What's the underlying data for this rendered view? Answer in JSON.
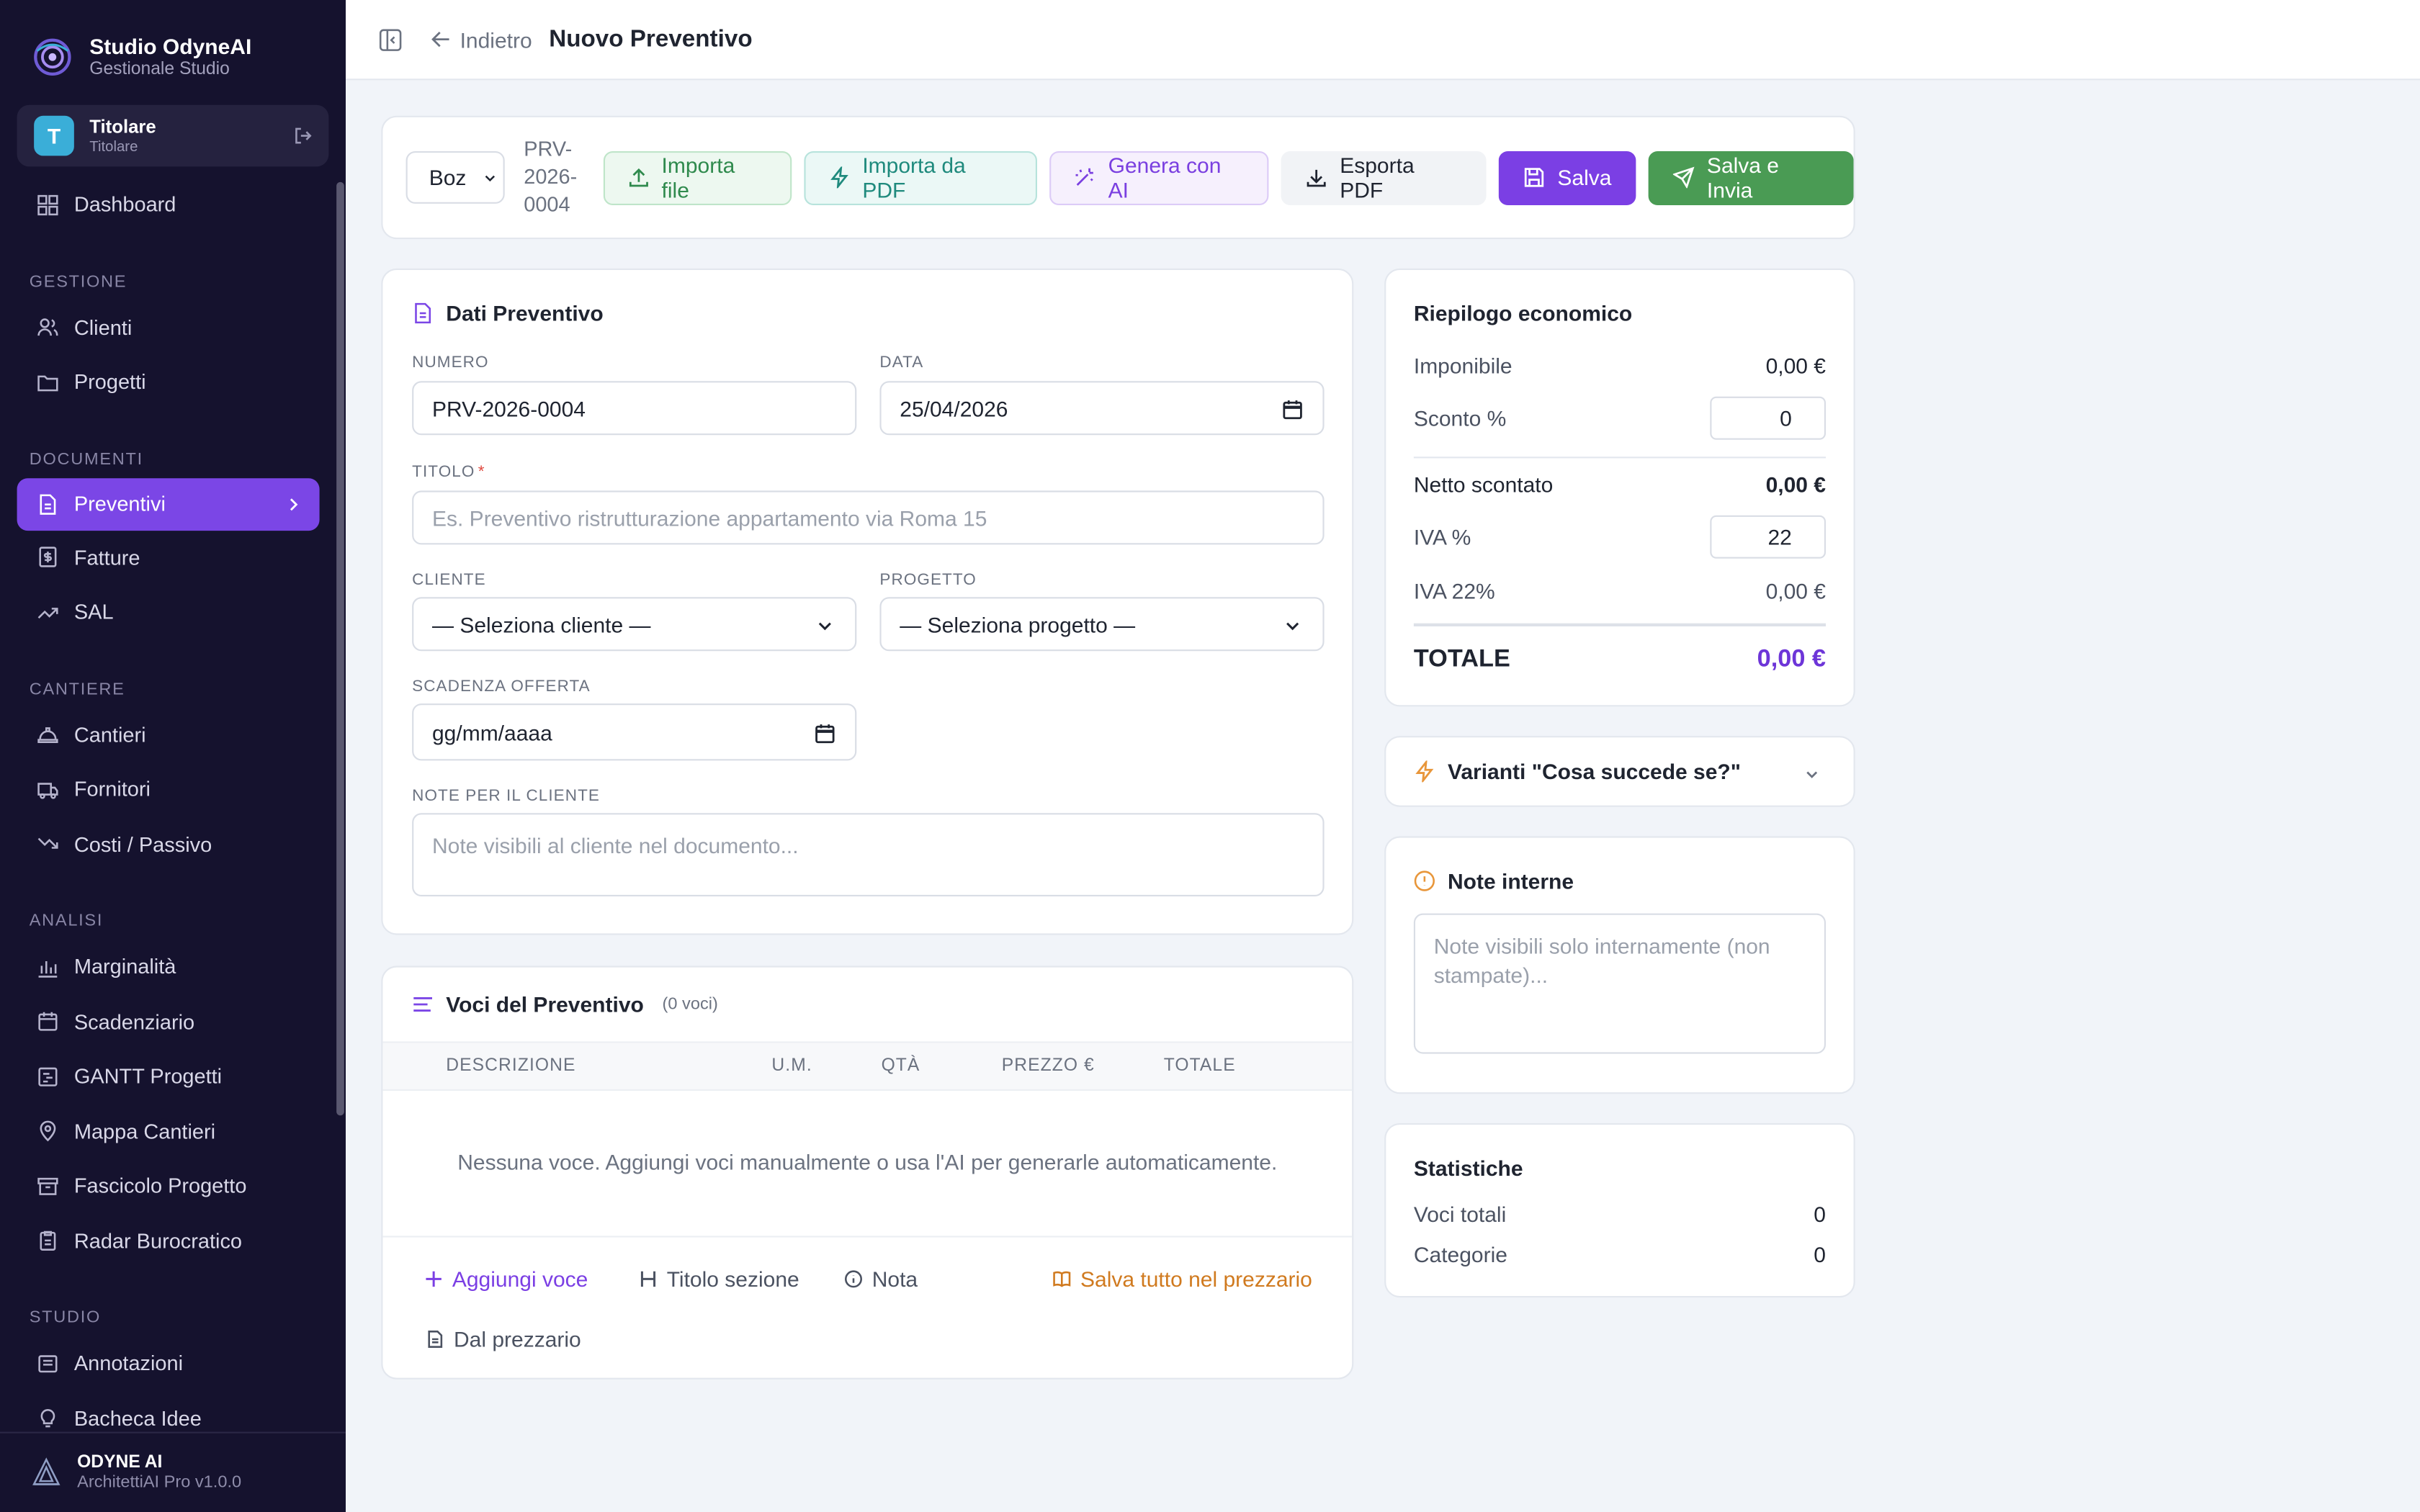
{
  "brand": {
    "name": "Studio OdyneAI",
    "subtitle": "Gestionale Studio"
  },
  "user": {
    "initial": "T",
    "name": "Titolare",
    "role": "Titolare"
  },
  "nav": {
    "dashboard": "Dashboard",
    "sections": {
      "gestione": "GESTIONE",
      "documenti": "DOCUMENTI",
      "cantiere": "CANTIERE",
      "analisi": "ANALISI",
      "studio": "STUDIO"
    },
    "items": {
      "clienti": "Clienti",
      "progetti": "Progetti",
      "preventivi": "Preventivi",
      "fatture": "Fatture",
      "sal": "SAL",
      "cantieri": "Cantieri",
      "fornitori": "Fornitori",
      "costi": "Costi / Passivo",
      "marginalita": "Marginalità",
      "scadenziario": "Scadenziario",
      "gantt": "GANTT Progetti",
      "mappa": "Mappa Cantieri",
      "fascicolo": "Fascicolo Progetto",
      "radar": "Radar Burocratico",
      "annotazioni": "Annotazioni",
      "bacheca": "Bacheca Idee"
    }
  },
  "footer": {
    "name": "ODYNE AI",
    "version": "ArchitettiAI Pro v1.0.0"
  },
  "header": {
    "back": "Indietro",
    "title": "Nuovo Preventivo"
  },
  "toolbar": {
    "status": "Boz",
    "doc_number_lines": [
      "PRV-",
      "2026-",
      "0004"
    ],
    "import_file": "Importa file",
    "import_pdf": "Importa da PDF",
    "generate_ai": "Genera con AI",
    "export_pdf": "Esporta PDF",
    "save": "Salva",
    "save_send": "Salva e Invia"
  },
  "dati": {
    "title": "Dati Preventivo",
    "numero_label": "NUMERO",
    "numero_value": "PRV-2026-0004",
    "data_label": "DATA",
    "data_value": "25/04/2026",
    "titolo_label": "TITOLO",
    "titolo_required": "*",
    "titolo_placeholder": "Es. Preventivo ristrutturazione appartamento via Roma 15",
    "cliente_label": "CLIENTE",
    "cliente_value": "— Seleziona cliente —",
    "progetto_label": "PROGETTO",
    "progetto_value": "— Seleziona progetto —",
    "scadenza_label": "SCADENZA OFFERTA",
    "scadenza_value": "gg/mm/aaaa",
    "note_label": "NOTE PER IL CLIENTE",
    "note_placeholder": "Note visibili al cliente nel documento..."
  },
  "voci": {
    "title": "Voci del Preventivo",
    "count": "(0 voci)",
    "columns": [
      "DESCRIZIONE",
      "U.M.",
      "QTÀ",
      "PREZZO €",
      "TOTALE"
    ],
    "empty": "Nessuna voce. Aggiungi voci manualmente o usa l'AI per generarle automaticamente.",
    "add_item": "Aggiungi voce",
    "section_title": "Titolo sezione",
    "note": "Nota",
    "save_all": "Salva tutto nel prezzario",
    "from_price_list": "Dal prezzario"
  },
  "riepilogo": {
    "title": "Riepilogo economico",
    "imponibile_label": "Imponibile",
    "imponibile_value": "0,00 €",
    "sconto_label": "Sconto %",
    "sconto_value": "0",
    "netto_label": "Netto scontato",
    "netto_value": "0,00 €",
    "iva_label": "IVA %",
    "iva_value": "22",
    "iva22_label": "IVA 22%",
    "iva22_value": "0,00 €",
    "totale_label": "TOTALE",
    "totale_value": "0,00 €"
  },
  "varianti": {
    "title": "Varianti \"Cosa succede se?\""
  },
  "note_interne": {
    "title": "Note interne",
    "placeholder_lines": [
      "Note visibili solo internamente (non",
      "stampate)..."
    ]
  },
  "statistiche": {
    "title": "Statistiche",
    "voci_label": "Voci totali",
    "voci_value": "0",
    "categorie_label": "Categorie",
    "categorie_value": "0"
  },
  "colors": {
    "sidebar_bg": "#15122e",
    "accent_purple": "#7b3fe4",
    "accent_green": "#4a9b54",
    "total_purple": "#6d35d8",
    "warning_orange": "#e8963a",
    "brand_blue": "#3aaed8"
  }
}
